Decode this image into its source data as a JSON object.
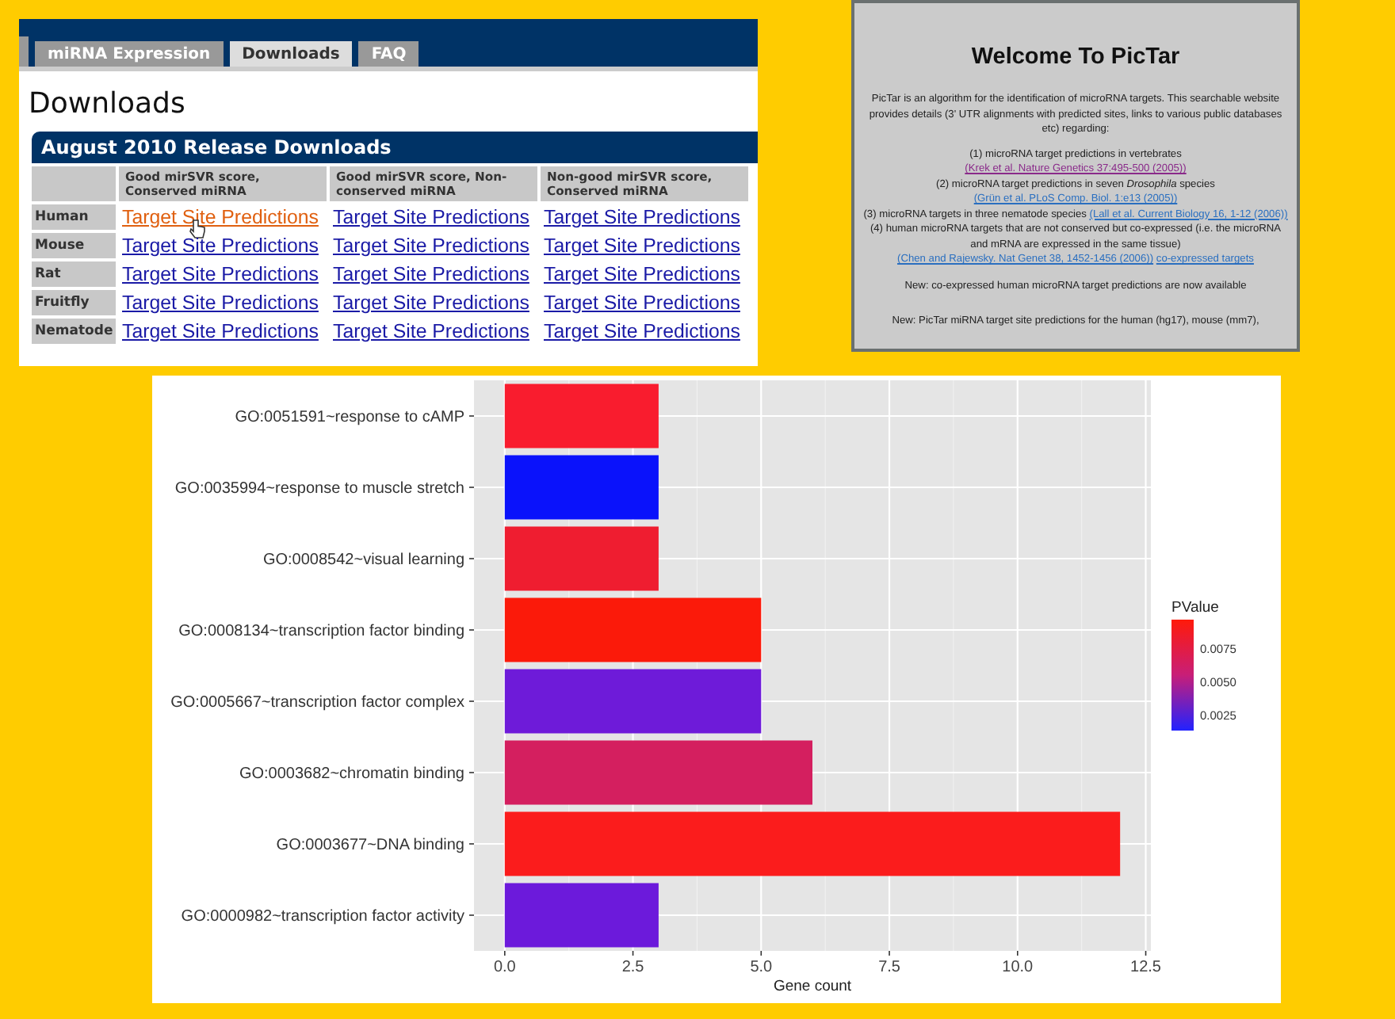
{
  "mirna_site": {
    "tabs": [
      {
        "label": "miRNA Expression",
        "selected": false
      },
      {
        "label": "Downloads",
        "selected": true
      },
      {
        "label": "FAQ",
        "selected": false
      }
    ],
    "heading": "Downloads",
    "table": {
      "title": "August 2010 Release Downloads",
      "columns": [
        "Good mirSVR score, Conserved miRNA",
        "Good mirSVR score, Non-conserved miRNA",
        "Non-good mirSVR score, Conserved miRNA"
      ],
      "rows": [
        {
          "label": "Human",
          "links": [
            {
              "text": "Target Site Predictions",
              "hovered": true
            },
            {
              "text": "Target Site Predictions",
              "hovered": false
            },
            {
              "text": "Target Site Predictions",
              "hovered": false
            }
          ]
        },
        {
          "label": "Mouse",
          "links": [
            {
              "text": "Target Site Predictions",
              "hovered": false
            },
            {
              "text": "Target Site Predictions",
              "hovered": false
            },
            {
              "text": "Target Site Predictions",
              "hovered": false
            }
          ]
        },
        {
          "label": "Rat",
          "links": [
            {
              "text": "Target Site Predictions",
              "hovered": false
            },
            {
              "text": "Target Site Predictions",
              "hovered": false
            },
            {
              "text": "Target Site Predictions",
              "hovered": false
            }
          ]
        },
        {
          "label": "Fruitfly",
          "links": [
            {
              "text": "Target Site Predictions",
              "hovered": false
            },
            {
              "text": "Target Site Predictions",
              "hovered": false
            },
            {
              "text": "Target Site Predictions",
              "hovered": false
            }
          ]
        },
        {
          "label": "Nematode",
          "links": [
            {
              "text": "Target Site Predictions",
              "hovered": false
            },
            {
              "text": "Target Site Predictions",
              "hovered": false
            },
            {
              "text": "Target Site Predictions",
              "hovered": false
            }
          ]
        }
      ]
    }
  },
  "pictar_site": {
    "title": "Welcome To PicTar",
    "intro": "PicTar is an algorithm for the identification of microRNA targets. This searchable website provides details (3' UTR alignments with predicted sites, links to various public databases etc) regarding:",
    "items": [
      {
        "text": "(1) microRNA target predictions in vertebrates",
        "links": [
          {
            "text": "(Krek et al. Nature Genetics 37:495-500 (2005))",
            "visited": true
          }
        ]
      },
      {
        "text": "(2) microRNA target predictions in seven *Drosophila* species",
        "links": [
          {
            "text": "(Grün et al. PLoS Comp. Biol. 1:e13 (2005))",
            "visited": false
          }
        ]
      },
      {
        "text": "(3) microRNA targets in three nematode species",
        "links": [
          {
            "text": "(Lall et al. Current Biology 16, 1-12 (2006))",
            "visited": false
          }
        ]
      },
      {
        "text": "(4) human microRNA targets that are not conserved but co-expressed (i.e. the microRNA and mRNA are expressed in the same tissue)",
        "links": [
          {
            "text": "(Chen and Rajewsky. Nat Genet 38, 1452-1456 (2006))",
            "visited": false
          },
          {
            "text": "co-expressed targets",
            "visited": false
          }
        ]
      }
    ],
    "news": [
      "New: co-expressed human microRNA target predictions are now available",
      "New: PicTar miRNA target site predictions for the human (hg17), mouse (mm7),"
    ]
  },
  "go_chart": {
    "chart_data": {
      "type": "bar",
      "orientation": "horizontal",
      "xlabel": "Gene count",
      "categories": [
        "GO:0051591~response to cAMP",
        "GO:0035994~response to muscle stretch",
        "GO:0008542~visual learning",
        "GO:0008134~transcription factor binding",
        "GO:0005667~transcription factor complex",
        "GO:0003682~chromatin binding",
        "GO:0003677~DNA binding",
        "GO:0000982~transcription factor activity"
      ],
      "values": [
        3,
        3,
        3,
        5,
        5,
        6,
        12,
        3
      ],
      "colors": [
        "#f91c2e",
        "#0a12fb",
        "#ef1d30",
        "#fb1a0a",
        "#6e1bd9",
        "#d41f5f",
        "#fb1c1c",
        "#6c1adb"
      ],
      "xlim": [
        -0.6,
        12.6
      ],
      "grid": true,
      "xticks": [
        {
          "value": 0,
          "label": "0.0"
        },
        {
          "value": 2.5,
          "label": "2.5"
        },
        {
          "value": 5,
          "label": "5.0"
        },
        {
          "value": 7.5,
          "label": "7.5"
        },
        {
          "value": 10,
          "label": "10.0"
        },
        {
          "value": 12.5,
          "label": "12.5"
        }
      ]
    },
    "legend": {
      "title": "PValue",
      "ticks": [
        "0.0075",
        "0.0050",
        "0.0025"
      ]
    }
  }
}
